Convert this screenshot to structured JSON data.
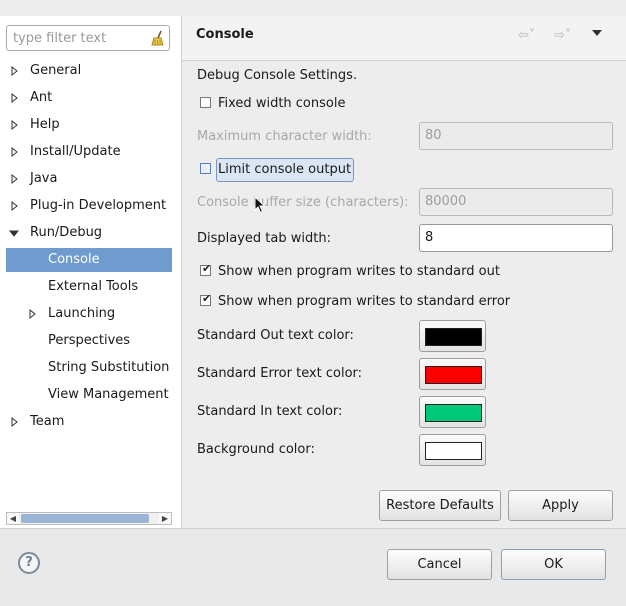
{
  "filter": {
    "placeholder": "type filter text"
  },
  "tree": {
    "items": [
      {
        "label": "General",
        "expander": "right"
      },
      {
        "label": "Ant",
        "expander": "right"
      },
      {
        "label": "Help",
        "expander": "right"
      },
      {
        "label": "Install/Update",
        "expander": "right"
      },
      {
        "label": "Java",
        "expander": "right"
      },
      {
        "label": "Plug-in Development",
        "expander": "right"
      },
      {
        "label": "Run/Debug",
        "expander": "down"
      },
      {
        "label": "Console",
        "selected": true
      },
      {
        "label": "External Tools"
      },
      {
        "label": "Launching",
        "expander": "right"
      },
      {
        "label": "Perspectives"
      },
      {
        "label": "String Substitution"
      },
      {
        "label": "View Management"
      },
      {
        "label": "Team",
        "expander": "right"
      }
    ]
  },
  "page": {
    "title": "Console",
    "description": "Debug Console Settings.",
    "fixed_width": {
      "label": "Fixed width console",
      "checked": false
    },
    "max_char_width": {
      "label": "Maximum character width:",
      "value": "80"
    },
    "limit_output": {
      "label": "Limit console output",
      "checked": false
    },
    "buffer_size": {
      "label": "Console buffer size (characters):",
      "value": "80000"
    },
    "tab_width": {
      "label": "Displayed tab width:",
      "value": "8"
    },
    "show_stdout": {
      "label": "Show when program writes to standard out",
      "checked": true
    },
    "show_stderr": {
      "label": "Show when program writes to standard error",
      "checked": true
    },
    "colors": {
      "stdout": {
        "label": "Standard Out text color:",
        "value": "#000000"
      },
      "stderr": {
        "label": "Standard Error text color:",
        "value": "#ff0000"
      },
      "stdin": {
        "label": "Standard In text color:",
        "value": "#00c87a"
      },
      "background": {
        "label": "Background color:",
        "value": "#ffffff"
      }
    },
    "restore_defaults": "Restore Defaults",
    "apply": "Apply"
  },
  "footer": {
    "help_glyph": "?",
    "cancel": "Cancel",
    "ok": "OK"
  }
}
